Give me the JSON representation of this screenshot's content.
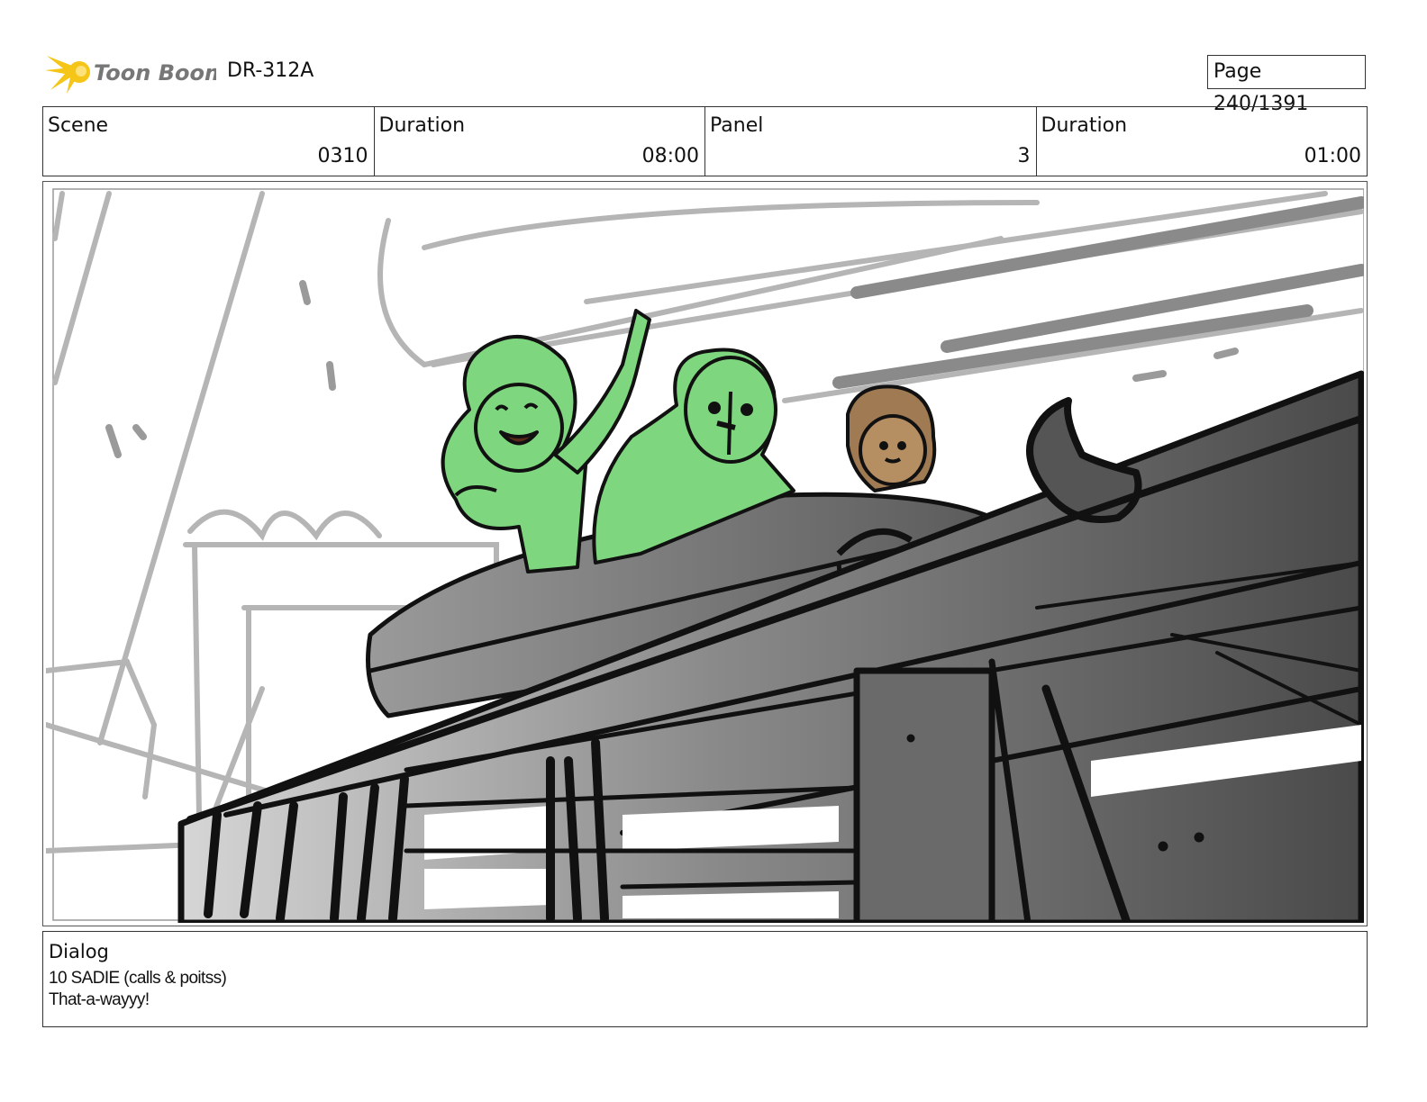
{
  "header": {
    "brand": "Toon Boom",
    "doc_id": "DR-312A",
    "page_label": "Page",
    "page_value": "240/1391"
  },
  "info": {
    "scene_label": "Scene",
    "scene_value": "0310",
    "duration_label": "Duration",
    "duration_value": "08:00",
    "panel_label": "Panel",
    "panel_value": "3",
    "panel_duration_label": "Duration",
    "panel_duration_value": "01:00"
  },
  "dialog": {
    "title": "Dialog",
    "lines": [
      "10 SADIE (calls & poitss)",
      "That-a-wayyy!"
    ]
  },
  "colors": {
    "character_green": "#7ed67e",
    "character_brown": "#a07a52",
    "logo_yellow": "#f5c518"
  }
}
